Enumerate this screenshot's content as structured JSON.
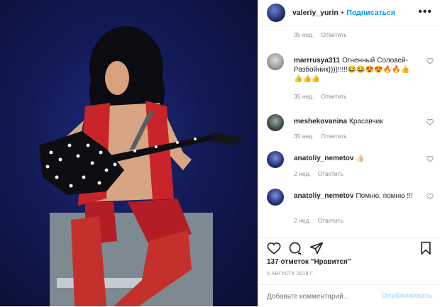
{
  "header": {
    "username": "valeriy_yurin",
    "separator": "•",
    "follow_label": "Подписаться",
    "more_label": "•••"
  },
  "comments": [
    {
      "username": "",
      "text": "",
      "time": "35 нед.",
      "reply_label": "Ответить",
      "has_avatar": false
    },
    {
      "username": "marrrusya311",
      "text": "Огненный Соловей-Разбойник))))!!!!!😂😂😍😍🔥🔥👍👍👍👍",
      "time": "35 нед.",
      "reply_label": "Ответить"
    },
    {
      "username": "meshekovanina",
      "text": "Красавчик",
      "time": "35 нед.",
      "reply_label": "Ответить"
    },
    {
      "username": "anatoliy_nemetov",
      "text": "👍🏻",
      "time": "2 нед.",
      "reply_label": "Ответить"
    },
    {
      "username": "anatoliy_nemetov",
      "text": "Помню, помню !!!",
      "time": "2 нед.",
      "reply_label": "Ответить"
    }
  ],
  "actions": {
    "icons": [
      "heart-icon",
      "comment-icon",
      "share-icon",
      "bookmark-icon"
    ]
  },
  "likes": "137 отметок \"Нравится\"",
  "date": "5 АВГУСТА 2019 Г.",
  "add_comment": {
    "placeholder": "Добавьте комментарий...",
    "post_label": "Опубликовать"
  },
  "colors": {
    "accent": "#0095f6",
    "post_disabled": "#b2dffc",
    "muted": "#8e8e8e",
    "photo_bg": "#121a55"
  }
}
